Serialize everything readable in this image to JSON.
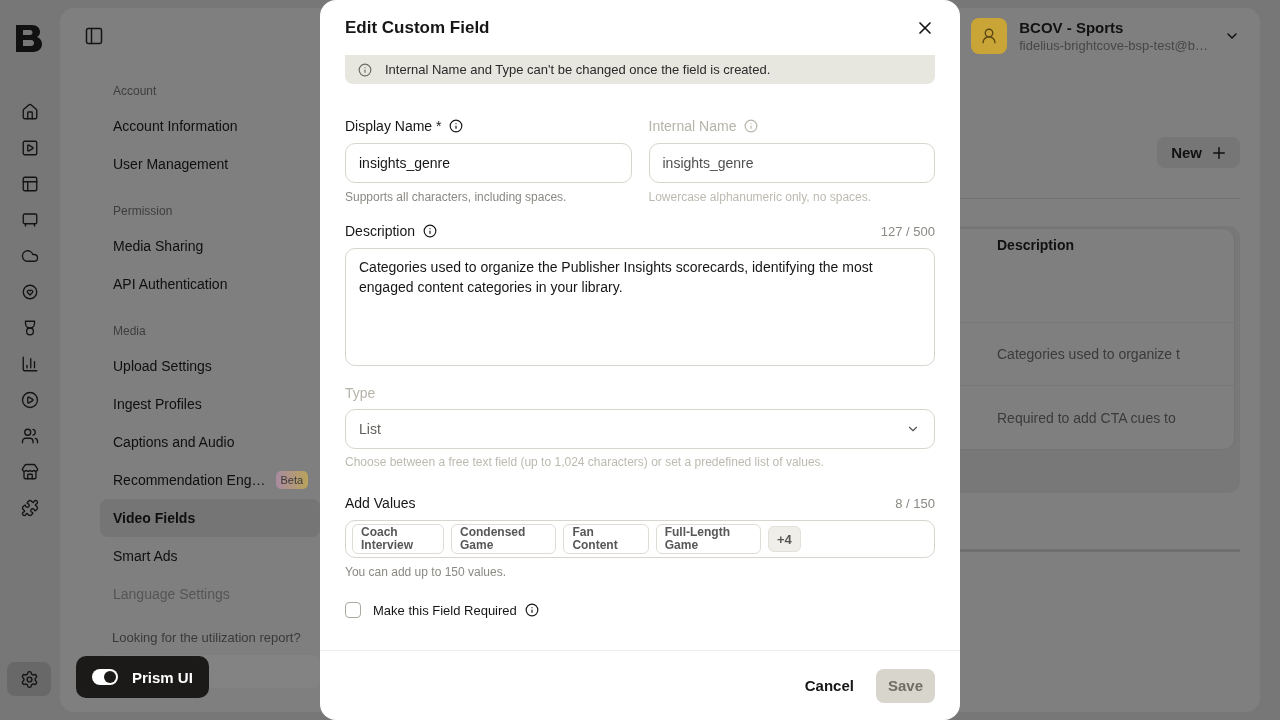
{
  "rail": {
    "items": [
      {
        "selected": false
      },
      {
        "selected": false
      },
      {
        "selected": false
      },
      {
        "selected": false
      },
      {
        "selected": false
      },
      {
        "selected": false
      },
      {
        "selected": false
      },
      {
        "selected": false
      },
      {
        "selected": false
      },
      {
        "selected": false
      },
      {
        "selected": false
      },
      {
        "selected": false
      }
    ],
    "settings": {
      "selected": true
    }
  },
  "settings_nav": {
    "sections": [
      {
        "title": "Account",
        "items": [
          {
            "label": "Account Information",
            "selected": false,
            "disabled": false
          },
          {
            "label": "User Management",
            "selected": false,
            "disabled": false
          }
        ]
      },
      {
        "title": "Permission",
        "items": [
          {
            "label": "Media Sharing",
            "selected": false,
            "disabled": false
          },
          {
            "label": "API Authentication",
            "selected": false,
            "disabled": false
          }
        ]
      },
      {
        "title": "Media",
        "items": [
          {
            "label": "Upload Settings",
            "selected": false,
            "disabled": false
          },
          {
            "label": "Ingest Profiles",
            "selected": false,
            "disabled": false
          },
          {
            "label": "Captions and Audio",
            "selected": false,
            "disabled": false
          },
          {
            "label": "Recommendation Eng…",
            "badge": "Beta",
            "selected": false,
            "disabled": false
          },
          {
            "label": "Video Fields",
            "selected": true,
            "disabled": false
          },
          {
            "label": "Smart Ads",
            "selected": false,
            "disabled": false
          },
          {
            "label": "Language Settings",
            "selected": false,
            "disabled": true
          }
        ]
      }
    ],
    "note": "Looking for the utilization report?"
  },
  "account": {
    "name": "BCOV - Sports",
    "email": "fidelius-brightcove-bsp-test@b…"
  },
  "toolbar": {
    "new_button": "New"
  },
  "table": {
    "columns": [
      "Description"
    ],
    "rows": [
      {},
      {
        "description": "Categories used to organize t"
      },
      {
        "description": "Required to add CTA cues to"
      }
    ]
  },
  "dialog": {
    "title": "Edit Custom Field",
    "notice": "Internal Name and Type can't be changed once the field is created.",
    "fields": [
      {
        "label": "Display Name *",
        "value": "insights_genre",
        "hint": "Supports all characters, including spaces.",
        "disabled": false
      },
      {
        "label": "Internal Name",
        "value": "insights_genre",
        "hint": "Lowercase alphanumeric only, no spaces.",
        "disabled": true
      }
    ],
    "description": {
      "label": "Description",
      "counter": "127 / 500",
      "value": "Categories used to organize the Publisher Insights scorecards, identifying the most engaged content categories in your library."
    },
    "type": {
      "label": "Type",
      "value": "List",
      "hint": "Choose between a free text field (up to 1,024 characters) or set a predefined list of values.",
      "disabled": true
    },
    "values": {
      "label": "Add Values",
      "counter": "8 / 150",
      "tags": [
        {
          "label": "Coach Interview"
        },
        {
          "label": "Condensed Game"
        },
        {
          "label": "Fan Content"
        },
        {
          "label": "Full-Length Game"
        }
      ],
      "more": "+4",
      "hint": "You can add up to 150 values."
    },
    "required": {
      "label": "Make this Field Required",
      "checked": false
    },
    "buttons": [
      {
        "label": "Cancel",
        "kind": "text",
        "disabled": false
      },
      {
        "label": "Save",
        "kind": "primary",
        "disabled": true
      }
    ]
  },
  "toast": {
    "label": "Prism UI",
    "on": true
  }
}
